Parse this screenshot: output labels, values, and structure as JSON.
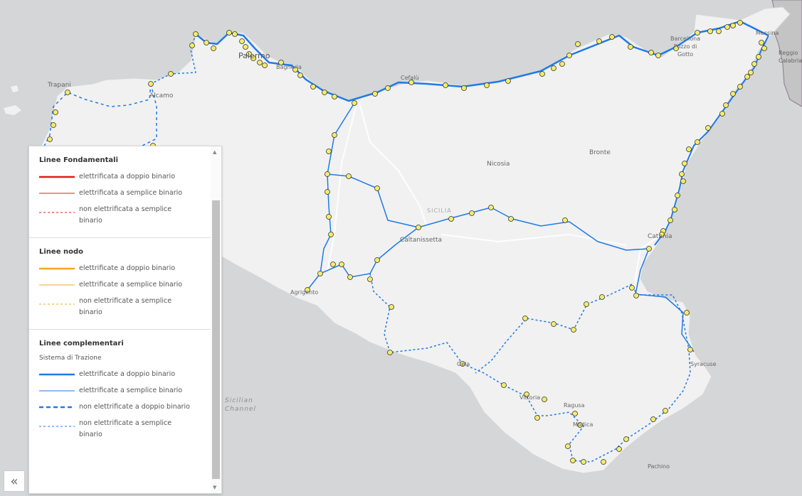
{
  "map": {
    "labels": {
      "palermo": "Palermo",
      "trapani": "Trapani",
      "alcamo": "Alcamo",
      "bagheria": "Bagheria",
      "cefalu": "Cefalù",
      "barcellona": "Barcellona\nPozzo di\nGotto",
      "messina": "Messina",
      "reggio": "Reggio\nCalabria",
      "nicosia": "Nicosia",
      "bronte": "Bronte",
      "sicilia": "SICILIA",
      "caltanissetta": "Caltanissetta",
      "catania": "Catania",
      "agrigento": "Agrigento",
      "gela": "Gela",
      "vittoria": "Vittoria",
      "ragusa": "Ragusa",
      "modica": "Modica",
      "syracuse": "Syracuse",
      "pachino": "Pachino",
      "sicilian_channel": "Sicilian\nChannel"
    }
  },
  "legend": {
    "fondamentali": {
      "title": "Linee Fondamentali",
      "items": [
        "elettrificata a doppio binario",
        "elettrificata a semplice binario",
        "non elettrificata a semplice binario"
      ]
    },
    "nodo": {
      "title": "Linee nodo",
      "items": [
        "elettrificate a doppio binario",
        "elettrificate a semplice binario",
        "non elettrificate a semplice binario"
      ]
    },
    "complementari": {
      "title": "Linee complementari",
      "subtitle": "Sistema di Trazione",
      "items": [
        "elettrificate a doppio binario",
        "elettrificate a semplice binario",
        "non elettrificate a doppio binario",
        "non elettrificate a semplice binario"
      ]
    }
  },
  "colors": {
    "fondamentali": "#e31a1c",
    "nodo": "#f5a623",
    "complementari": "#1f7ae8"
  },
  "controls": {
    "collapse_icon": "«",
    "scroll_up_icon": "▲",
    "scroll_down_icon": "▼"
  }
}
